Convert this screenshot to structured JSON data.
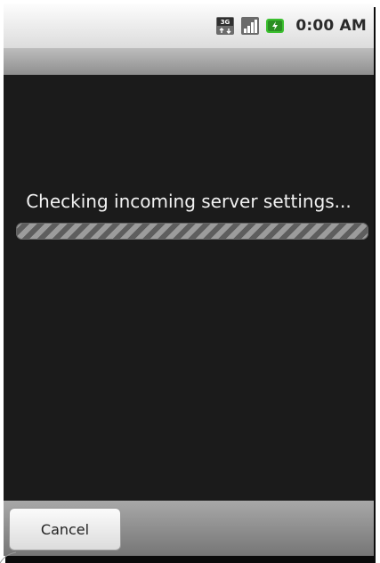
{
  "status_bar": {
    "network_icon": "3g-icon",
    "signal_icon": "signal-icon",
    "battery_icon": "battery-charging-icon",
    "time": "0:00 AM"
  },
  "main": {
    "message": "Checking incoming server settings...",
    "progress_indeterminate": true
  },
  "footer": {
    "cancel_label": "Cancel"
  },
  "colors": {
    "background": "#1b1b1b",
    "battery_green": "#3bbf2f"
  }
}
